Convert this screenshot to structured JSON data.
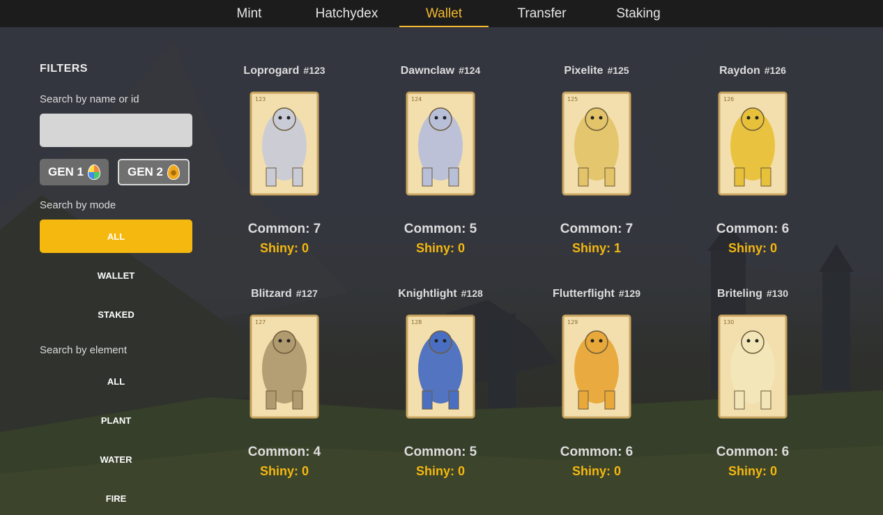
{
  "nav": {
    "tabs": [
      {
        "label": "Mint"
      },
      {
        "label": "Hatchydex"
      },
      {
        "label": "Wallet"
      },
      {
        "label": "Transfer"
      },
      {
        "label": "Staking"
      }
    ],
    "active_tab": "Wallet",
    "accent_color": "#f5b82e"
  },
  "sidebar": {
    "title": "FILTERS",
    "search_label": "Search by name or id",
    "search_value": "",
    "search_placeholder": "",
    "gen_buttons": [
      {
        "label": "GEN 1",
        "icon": "rainbow-egg-icon"
      },
      {
        "label": "GEN 2",
        "icon": "golden-egg-icon"
      }
    ],
    "mode_label": "Search by mode",
    "modes": [
      "ALL",
      "WALLET",
      "STAKED"
    ],
    "active_mode": "ALL",
    "element_label": "Search by element",
    "elements": [
      "ALL",
      "PLANT",
      "WATER",
      "FIRE"
    ]
  },
  "hatchies": [
    {
      "name": "Loprogard",
      "id": "#123",
      "common": "Common: 7",
      "shiny": "Shiny: 0",
      "color": "#c9cbd6",
      "card_no": "123"
    },
    {
      "name": "Dawnclaw",
      "id": "#124",
      "common": "Common: 5",
      "shiny": "Shiny: 0",
      "color": "#b8bfd9",
      "card_no": "124"
    },
    {
      "name": "Pixelite",
      "id": "#125",
      "common": "Common: 7",
      "shiny": "Shiny: 1",
      "color": "#e3c46a",
      "card_no": "125"
    },
    {
      "name": "Raydon",
      "id": "#126",
      "common": "Common: 6",
      "shiny": "Shiny: 0",
      "color": "#e8c13a",
      "card_no": "126"
    },
    {
      "name": "Blitzard",
      "id": "#127",
      "common": "Common: 4",
      "shiny": "Shiny: 0",
      "color": "#b09a70",
      "card_no": "127"
    },
    {
      "name": "Knightlight",
      "id": "#128",
      "common": "Common: 5",
      "shiny": "Shiny: 0",
      "color": "#4a6fc2",
      "card_no": "128"
    },
    {
      "name": "Flutterflight",
      "id": "#129",
      "common": "Common: 6",
      "shiny": "Shiny: 0",
      "color": "#e8a83a",
      "card_no": "129"
    },
    {
      "name": "Briteling",
      "id": "#130",
      "common": "Common: 6",
      "shiny": "Shiny: 0",
      "color": "#f2e6b8",
      "card_no": "130"
    }
  ]
}
